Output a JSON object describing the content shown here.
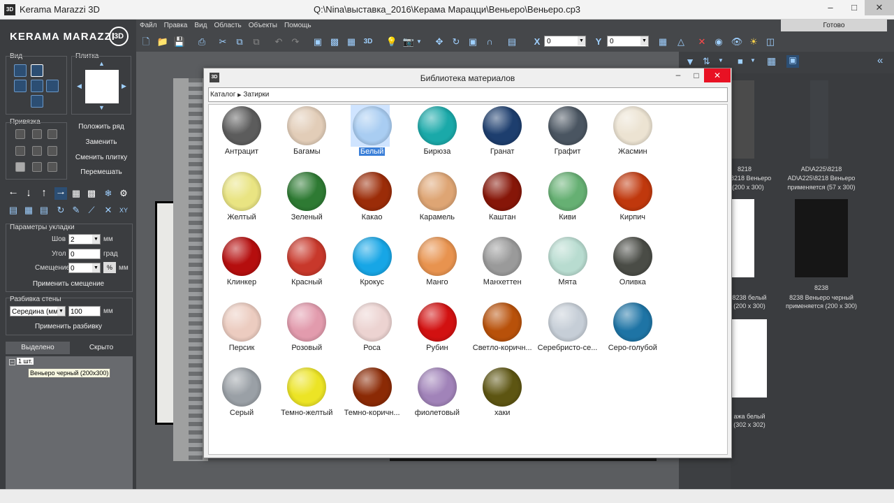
{
  "window": {
    "app_title": "Kerama Marazzi 3D",
    "path": "Q:\\Nina\\выставка_2016\\Керама Марацци\\Веньеро\\Веньеро.cp3",
    "app_icon": "3D"
  },
  "menu": [
    "Файл",
    "Правка",
    "Вид",
    "Область",
    "Объекты",
    "Помощь"
  ],
  "ready_label": "Готово",
  "toolbar": {
    "label_3d": "3D",
    "x_label": "X",
    "x_value": "0",
    "y_label": "Y",
    "y_value": "0"
  },
  "left": {
    "logo": "KERAMA MARAZZI",
    "logo_badge": "3D",
    "view_label": "Вид",
    "tile_label": "Плитка",
    "snap_label": "Привязка",
    "actions": [
      "Положить ряд",
      "Заменить",
      "Сменить плитку",
      "Перемешать"
    ],
    "layout_params": {
      "title": "Параметры укладки",
      "seam_label": "Шов",
      "seam_value": "2",
      "seam_unit": "мм",
      "angle_label": "Угол",
      "angle_value": "0",
      "angle_unit": "град",
      "offset_label": "Смещение",
      "offset_value": "0",
      "percent": "%",
      "offset_unit": "мм",
      "apply": "Применить смещение"
    },
    "wall_split": {
      "title": "Разбивка стены",
      "mode_value": "Середина (мм",
      "size_value": "100",
      "unit": "мм",
      "apply": "Применить разбивку"
    },
    "tabs": [
      "Выделено",
      "Скрыто"
    ],
    "tree": {
      "root": "1 шт.",
      "tooltip": "Веньеро черный (200x300)"
    }
  },
  "dialog": {
    "title": "Библиотека материалов",
    "icon": "3D",
    "breadcrumb": [
      "Каталог",
      "Затирки"
    ],
    "selected": "Белый",
    "materials": [
      {
        "name": "Антрацит",
        "color": "#5c5c5c"
      },
      {
        "name": "Багамы",
        "color": "#e2cdb8"
      },
      {
        "name": "Белый",
        "color": "#a9cdf2"
      },
      {
        "name": "Бирюза",
        "color": "#1aa9a9"
      },
      {
        "name": "Гранат",
        "color": "#1d3e6e"
      },
      {
        "name": "Графит",
        "color": "#4a5561"
      },
      {
        "name": "Жасмин",
        "color": "#ece3d2"
      },
      {
        "name": "Желтый",
        "color": "#e9e482"
      },
      {
        "name": "Зеленый",
        "color": "#2e7a33"
      },
      {
        "name": "Какао",
        "color": "#9b2c08"
      },
      {
        "name": "Карамель",
        "color": "#dea574"
      },
      {
        "name": "Каштан",
        "color": "#861608"
      },
      {
        "name": "Киви",
        "color": "#66b073"
      },
      {
        "name": "Кирпич",
        "color": "#c0380d"
      },
      {
        "name": "Клинкер",
        "color": "#b50e0e"
      },
      {
        "name": "Красный",
        "color": "#c8382b"
      },
      {
        "name": "Крокус",
        "color": "#17a6e6"
      },
      {
        "name": "Манго",
        "color": "#e8934f"
      },
      {
        "name": "Манхеттен",
        "color": "#9a9a9a"
      },
      {
        "name": "Мята",
        "color": "#b8dcd0"
      },
      {
        "name": "Оливка",
        "color": "#4a4c46"
      },
      {
        "name": "Персик",
        "color": "#ecccc0"
      },
      {
        "name": "Розовый",
        "color": "#e29bad"
      },
      {
        "name": "Роса",
        "color": "#ecd3d1"
      },
      {
        "name": "Рубин",
        "color": "#d21111"
      },
      {
        "name": "Светло-коричн...",
        "color": "#b8510a"
      },
      {
        "name": "Серебристо-се...",
        "color": "#c6ced7"
      },
      {
        "name": "Серо-голубой",
        "color": "#1e74a5"
      },
      {
        "name": "Серый",
        "color": "#9aa0a6"
      },
      {
        "name": "Темно-желтый",
        "color": "#ece425"
      },
      {
        "name": "Темно-коричн...",
        "color": "#8b2a05"
      },
      {
        "name": "фиолетовый",
        "color": "#a183b9"
      },
      {
        "name": "хаки",
        "color": "#5d5512"
      }
    ]
  },
  "right": {
    "items": [
      {
        "code": "8218",
        "name": "8218 Веньеро",
        "size": "(200 x 300)"
      },
      {
        "code": "AD\\A225\\8218",
        "name": "AD\\A225\\8218 Веньеро",
        "size": "применяется (57 x 300)"
      },
      {
        "code": "",
        "name": "8238 белый",
        "size": "(200 x 300)"
      },
      {
        "code": "8238",
        "name": "8238 Веньеро черный",
        "size": "применяется (200 x 300)"
      },
      {
        "code": "",
        "name": "ажа белый",
        "size": "(302 x 302)"
      }
    ]
  },
  "colors": {
    "accent": "#3a7fd8",
    "close": "#e81123"
  }
}
